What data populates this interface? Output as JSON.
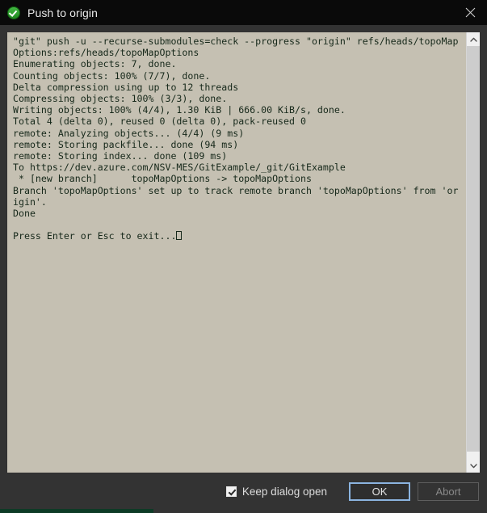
{
  "window": {
    "title": "Push to origin",
    "status_icon": "success-check-icon",
    "close_label": "close-icon",
    "accent_ok_border": "#8bb4e0",
    "console_bg": "#c5c0b2",
    "console_fg": "#16281a",
    "chrome_bg": "#333333",
    "titlebar_bg": "#0a0a0a"
  },
  "console": {
    "lines": [
      "\"git\" push -u --recurse-submodules=check --progress \"origin\" refs/heads/topoMap",
      "Options:refs/heads/topoMapOptions",
      "Enumerating objects: 7, done.",
      "Counting objects: 100% (7/7), done.",
      "Delta compression using up to 12 threads",
      "Compressing objects: 100% (3/3), done.",
      "Writing objects: 100% (4/4), 1.30 KiB | 666.00 KiB/s, done.",
      "Total 4 (delta 0), reused 0 (delta 0), pack-reused 0",
      "remote: Analyzing objects... (4/4) (9 ms)",
      "remote: Storing packfile... done (94 ms)",
      "remote: Storing index... done (109 ms)",
      "To https://dev.azure.com/NSV-MES/GitExample/_git/GitExample",
      " * [new branch]      topoMapOptions -> topoMapOptions",
      "Branch 'topoMapOptions' set up to track remote branch 'topoMapOptions' from 'or",
      "igin'.",
      "Done",
      "",
      "Press Enter or Esc to exit..."
    ],
    "cursor": "block-cursor"
  },
  "scrollbar": {
    "up_arrow": "chevron-up-icon",
    "down_arrow": "chevron-down-icon"
  },
  "footer": {
    "keep_dialog_open_label": "Keep dialog open",
    "keep_dialog_open_checked": true,
    "ok_label": "OK",
    "abort_label": "Abort"
  }
}
